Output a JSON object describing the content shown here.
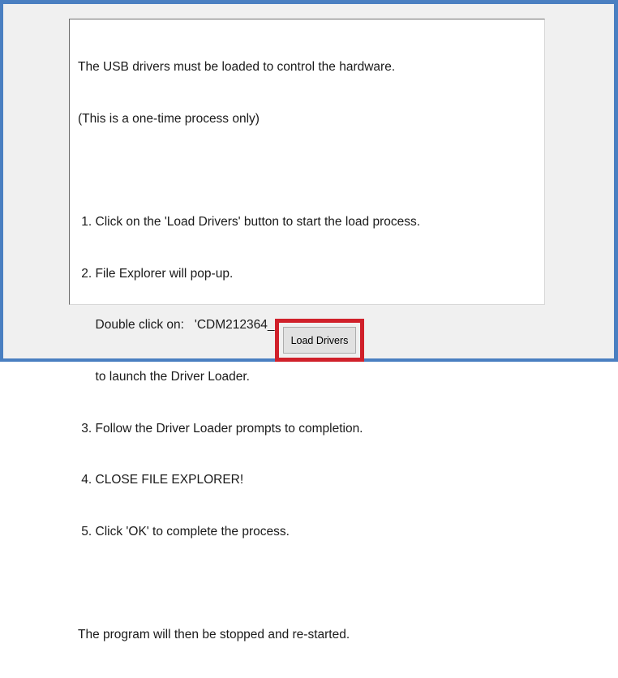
{
  "dialog": {
    "instruction_lines": [
      "The USB drivers must be loaded to control the hardware.",
      "(This is a one-time process only)",
      "",
      " 1. Click on the 'Load Drivers' button to start the load process.",
      " 2. File Explorer will pop-up.",
      "     Double click on:   'CDM212364_Setup.exe'",
      "     to launch the Driver Loader.",
      " 3. Follow the Driver Loader prompts to completion.",
      " 4. CLOSE FILE EXPLORER!",
      " 5. Click 'OK' to complete the process.",
      "",
      "The program will then be stopped and re-started."
    ],
    "load_button_label": "Load Drivers"
  },
  "colors": {
    "window_border": "#4a7fc1",
    "highlight_border": "#d0202a",
    "window_background": "#f0f0f0"
  }
}
